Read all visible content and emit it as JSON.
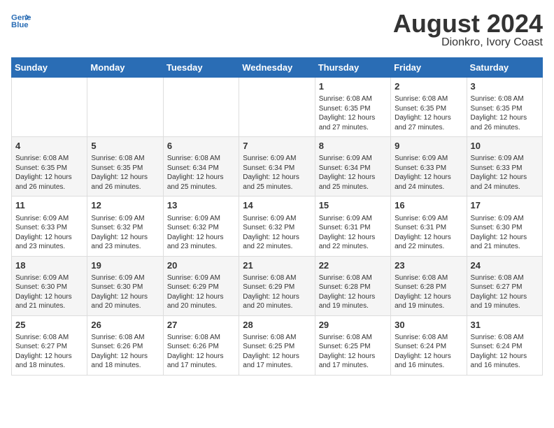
{
  "header": {
    "logo_line1": "General",
    "logo_line2": "Blue",
    "title": "August 2024",
    "subtitle": "Dionkro, Ivory Coast"
  },
  "days_of_week": [
    "Sunday",
    "Monday",
    "Tuesday",
    "Wednesday",
    "Thursday",
    "Friday",
    "Saturday"
  ],
  "weeks": [
    {
      "days": [
        {
          "num": "",
          "info": ""
        },
        {
          "num": "",
          "info": ""
        },
        {
          "num": "",
          "info": ""
        },
        {
          "num": "",
          "info": ""
        },
        {
          "num": "1",
          "info": "Sunrise: 6:08 AM\nSunset: 6:35 PM\nDaylight: 12 hours\nand 27 minutes."
        },
        {
          "num": "2",
          "info": "Sunrise: 6:08 AM\nSunset: 6:35 PM\nDaylight: 12 hours\nand 27 minutes."
        },
        {
          "num": "3",
          "info": "Sunrise: 6:08 AM\nSunset: 6:35 PM\nDaylight: 12 hours\nand 26 minutes."
        }
      ]
    },
    {
      "days": [
        {
          "num": "4",
          "info": "Sunrise: 6:08 AM\nSunset: 6:35 PM\nDaylight: 12 hours\nand 26 minutes."
        },
        {
          "num": "5",
          "info": "Sunrise: 6:08 AM\nSunset: 6:35 PM\nDaylight: 12 hours\nand 26 minutes."
        },
        {
          "num": "6",
          "info": "Sunrise: 6:08 AM\nSunset: 6:34 PM\nDaylight: 12 hours\nand 25 minutes."
        },
        {
          "num": "7",
          "info": "Sunrise: 6:09 AM\nSunset: 6:34 PM\nDaylight: 12 hours\nand 25 minutes."
        },
        {
          "num": "8",
          "info": "Sunrise: 6:09 AM\nSunset: 6:34 PM\nDaylight: 12 hours\nand 25 minutes."
        },
        {
          "num": "9",
          "info": "Sunrise: 6:09 AM\nSunset: 6:33 PM\nDaylight: 12 hours\nand 24 minutes."
        },
        {
          "num": "10",
          "info": "Sunrise: 6:09 AM\nSunset: 6:33 PM\nDaylight: 12 hours\nand 24 minutes."
        }
      ]
    },
    {
      "days": [
        {
          "num": "11",
          "info": "Sunrise: 6:09 AM\nSunset: 6:33 PM\nDaylight: 12 hours\nand 23 minutes."
        },
        {
          "num": "12",
          "info": "Sunrise: 6:09 AM\nSunset: 6:32 PM\nDaylight: 12 hours\nand 23 minutes."
        },
        {
          "num": "13",
          "info": "Sunrise: 6:09 AM\nSunset: 6:32 PM\nDaylight: 12 hours\nand 23 minutes."
        },
        {
          "num": "14",
          "info": "Sunrise: 6:09 AM\nSunset: 6:32 PM\nDaylight: 12 hours\nand 22 minutes."
        },
        {
          "num": "15",
          "info": "Sunrise: 6:09 AM\nSunset: 6:31 PM\nDaylight: 12 hours\nand 22 minutes."
        },
        {
          "num": "16",
          "info": "Sunrise: 6:09 AM\nSunset: 6:31 PM\nDaylight: 12 hours\nand 22 minutes."
        },
        {
          "num": "17",
          "info": "Sunrise: 6:09 AM\nSunset: 6:30 PM\nDaylight: 12 hours\nand 21 minutes."
        }
      ]
    },
    {
      "days": [
        {
          "num": "18",
          "info": "Sunrise: 6:09 AM\nSunset: 6:30 PM\nDaylight: 12 hours\nand 21 minutes."
        },
        {
          "num": "19",
          "info": "Sunrise: 6:09 AM\nSunset: 6:30 PM\nDaylight: 12 hours\nand 20 minutes."
        },
        {
          "num": "20",
          "info": "Sunrise: 6:09 AM\nSunset: 6:29 PM\nDaylight: 12 hours\nand 20 minutes."
        },
        {
          "num": "21",
          "info": "Sunrise: 6:08 AM\nSunset: 6:29 PM\nDaylight: 12 hours\nand 20 minutes."
        },
        {
          "num": "22",
          "info": "Sunrise: 6:08 AM\nSunset: 6:28 PM\nDaylight: 12 hours\nand 19 minutes."
        },
        {
          "num": "23",
          "info": "Sunrise: 6:08 AM\nSunset: 6:28 PM\nDaylight: 12 hours\nand 19 minutes."
        },
        {
          "num": "24",
          "info": "Sunrise: 6:08 AM\nSunset: 6:27 PM\nDaylight: 12 hours\nand 19 minutes."
        }
      ]
    },
    {
      "days": [
        {
          "num": "25",
          "info": "Sunrise: 6:08 AM\nSunset: 6:27 PM\nDaylight: 12 hours\nand 18 minutes."
        },
        {
          "num": "26",
          "info": "Sunrise: 6:08 AM\nSunset: 6:26 PM\nDaylight: 12 hours\nand 18 minutes."
        },
        {
          "num": "27",
          "info": "Sunrise: 6:08 AM\nSunset: 6:26 PM\nDaylight: 12 hours\nand 17 minutes."
        },
        {
          "num": "28",
          "info": "Sunrise: 6:08 AM\nSunset: 6:25 PM\nDaylight: 12 hours\nand 17 minutes."
        },
        {
          "num": "29",
          "info": "Sunrise: 6:08 AM\nSunset: 6:25 PM\nDaylight: 12 hours\nand 17 minutes."
        },
        {
          "num": "30",
          "info": "Sunrise: 6:08 AM\nSunset: 6:24 PM\nDaylight: 12 hours\nand 16 minutes."
        },
        {
          "num": "31",
          "info": "Sunrise: 6:08 AM\nSunset: 6:24 PM\nDaylight: 12 hours\nand 16 minutes."
        }
      ]
    }
  ]
}
